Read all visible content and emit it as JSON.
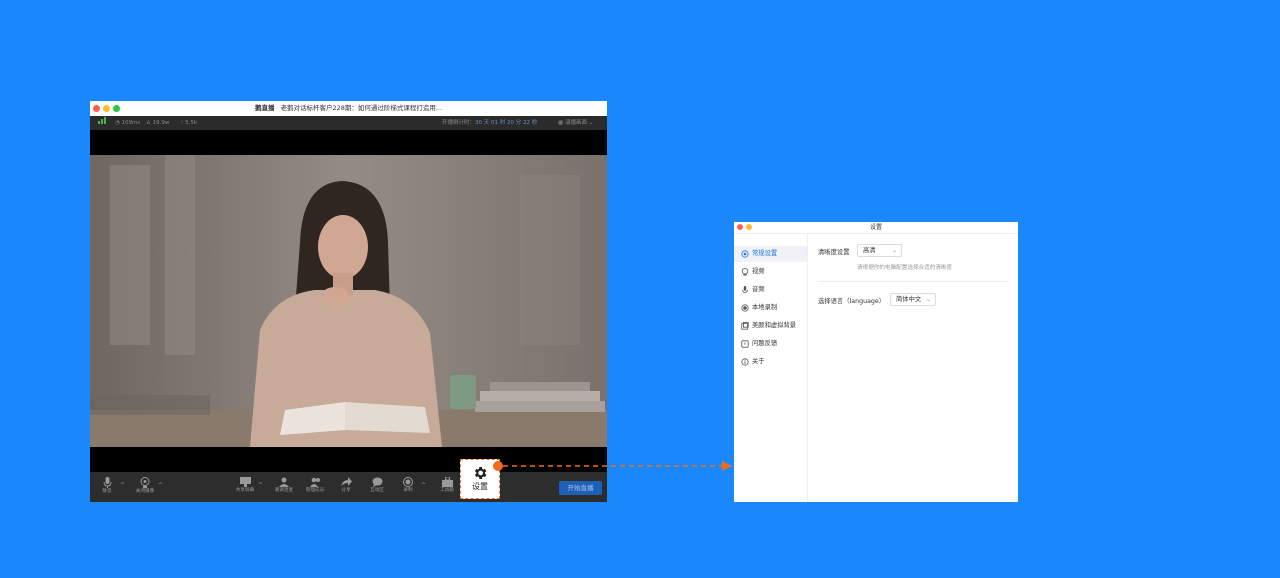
{
  "live_window": {
    "brand": "鹅直播",
    "title": "老鹅对话标杆客户228期：如何通过阶梯式课程打造用...",
    "status": {
      "latency": "109ms",
      "viewers": "19.9w",
      "likes": "5.5k",
      "countdown_label": "开播倒计时：",
      "countdown": "30 天 01 时 20 分 22 秒",
      "layout": "演播画面"
    },
    "toolbar": {
      "mic": "静音",
      "camera": "关闭摄像",
      "share": "共享屏幕",
      "invite": "邀请连麦",
      "members": "管理成员",
      "share_link": "分享",
      "interact": "互动区",
      "record": "录制",
      "tools": "工具箱",
      "settings": "设置",
      "start_live": "开始直播"
    }
  },
  "settings_dialog": {
    "title": "设置",
    "sidebar": [
      {
        "label": "常规设置",
        "icon": "gear-icon",
        "active": true
      },
      {
        "label": "视频",
        "icon": "camera-icon",
        "active": false
      },
      {
        "label": "音频",
        "icon": "microphone-icon",
        "active": false
      },
      {
        "label": "本地录制",
        "icon": "record-icon",
        "active": false
      },
      {
        "label": "美颜和虚拟背景",
        "icon": "beauty-icon",
        "active": false
      },
      {
        "label": "问题反馈",
        "icon": "feedback-icon",
        "active": false
      },
      {
        "label": "关于",
        "icon": "info-icon",
        "active": false
      }
    ],
    "general": {
      "clarity_label": "清晰度设置",
      "clarity_value": "高清",
      "clarity_hint": "请根据你的电脑配置选择合适的清晰度",
      "language_label": "选择语言（language）",
      "language_value": "简体中文"
    }
  },
  "colors": {
    "background": "#1a88fb",
    "accent": "#1a6ff0",
    "highlight": "#f26b1d"
  }
}
